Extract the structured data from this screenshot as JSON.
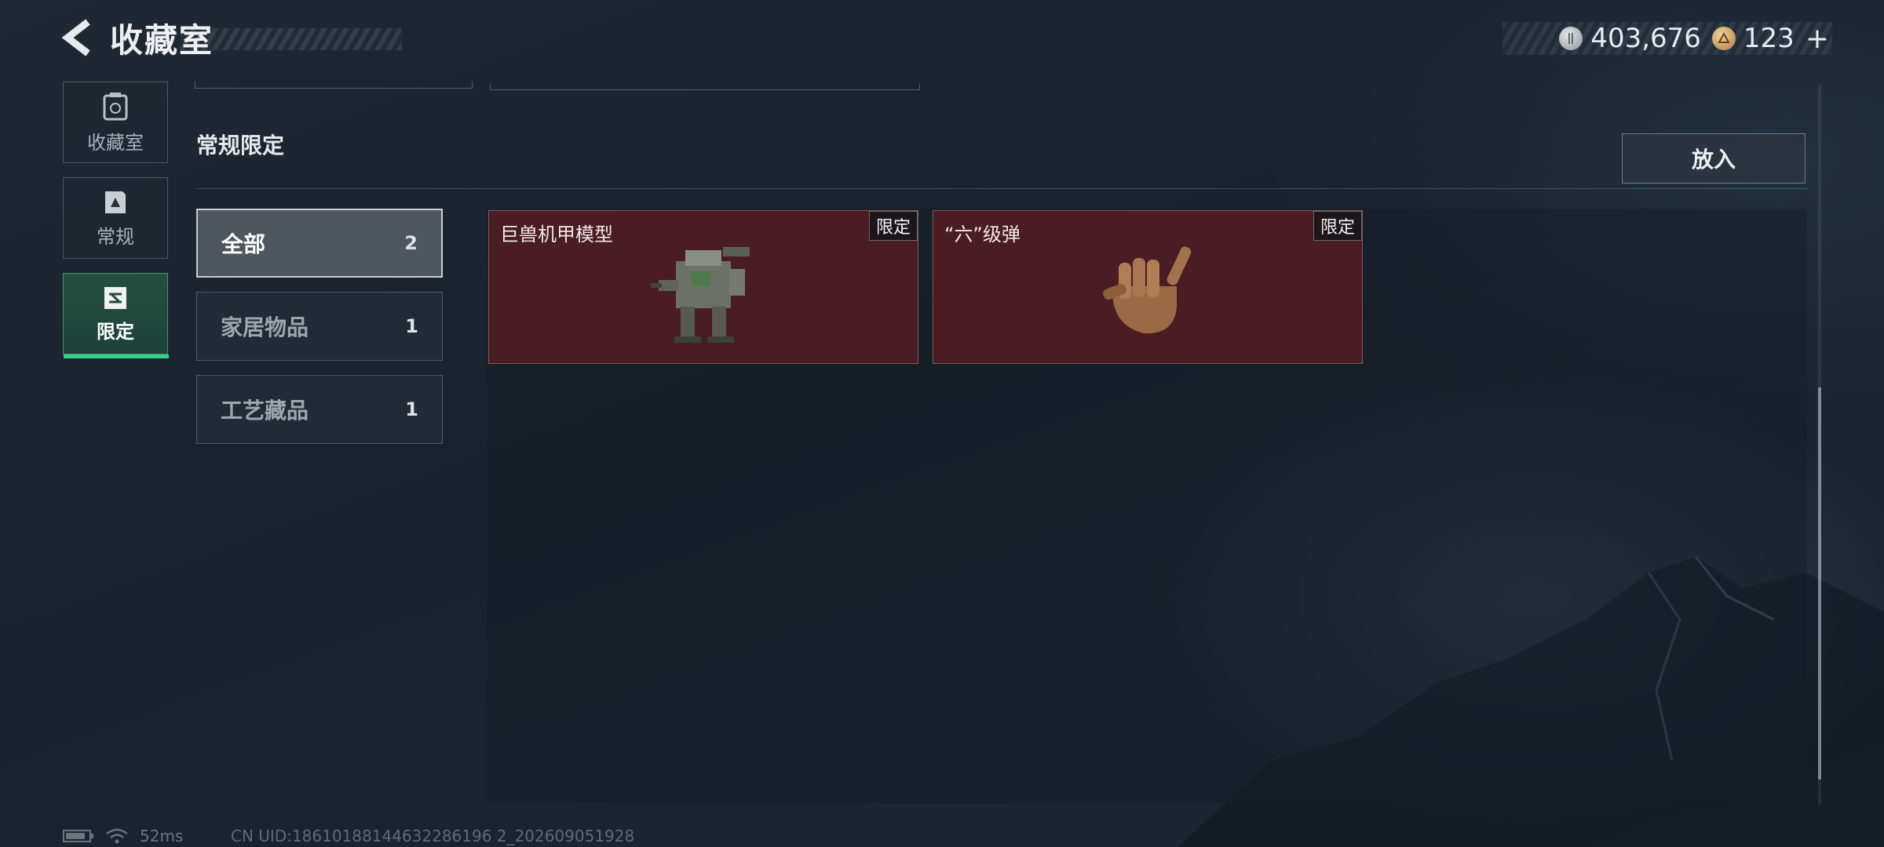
{
  "header": {
    "title": "收藏室",
    "currency": [
      {
        "icon": "silver-coin-icon",
        "value": "403,676"
      },
      {
        "icon": "gold-coin-icon",
        "value": "123"
      }
    ],
    "add_symbol": "+"
  },
  "nav": {
    "items": [
      {
        "label": "收藏室",
        "icon": "collection-room-icon"
      },
      {
        "label": "常规",
        "icon": "regular-card-icon"
      },
      {
        "label": "限定",
        "icon": "limited-card-icon",
        "active": true
      }
    ]
  },
  "section": {
    "title": "常规限定",
    "place_button": "放入"
  },
  "categories": [
    {
      "name": "全部",
      "count": "2",
      "active": true
    },
    {
      "name": "家居物品",
      "count": "1"
    },
    {
      "name": "工艺藏品",
      "count": "1"
    }
  ],
  "items": [
    {
      "name": "巨兽机甲模型",
      "tag": "限定",
      "icon": "mech-model-icon"
    },
    {
      "name": "“六”级弹",
      "tag": "限定",
      "icon": "bullet-hand-icon"
    }
  ],
  "footer": {
    "ping": "52ms",
    "uid": "CN UID:18610188144632286196 2_202609051928"
  },
  "colors": {
    "card_bg": "#4a1c23",
    "active_accent": "#35d38a"
  }
}
